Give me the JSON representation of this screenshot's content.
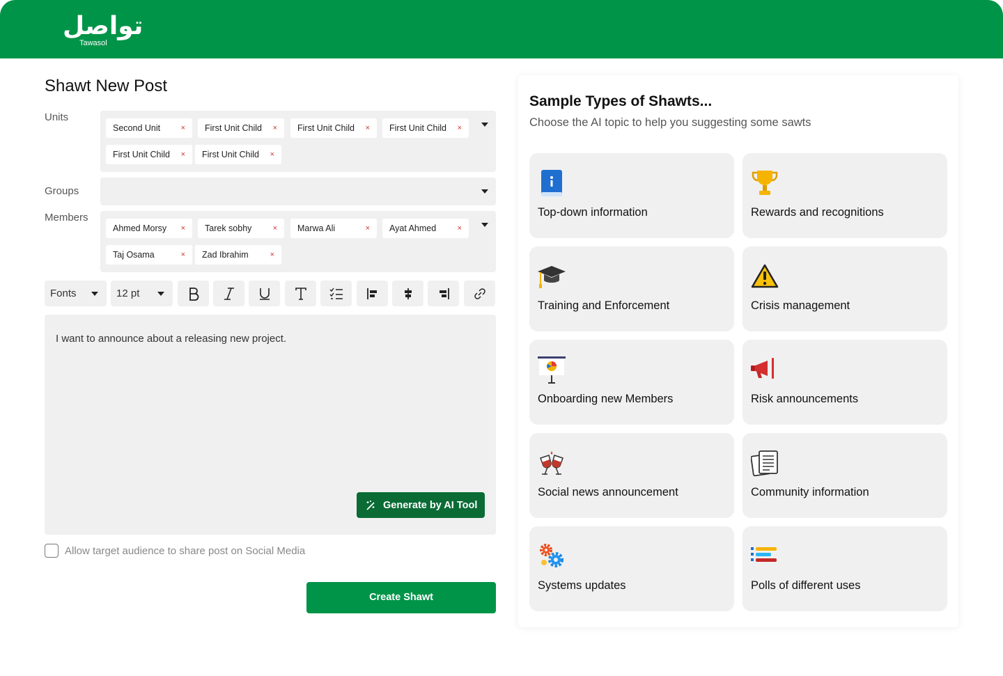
{
  "brand": {
    "logo_arabic": "تواصل",
    "logo_english": "Tawasol"
  },
  "form": {
    "title": "Shawt New Post",
    "units": {
      "label": "Units",
      "chips": [
        "Second Unit",
        "First Unit Child",
        "First Unit Child",
        "First Unit Child",
        "First Unit Child",
        "First Unit Child"
      ],
      "remove_glyph": "×"
    },
    "groups": {
      "label": "Groups"
    },
    "members": {
      "label": "Members",
      "chips": [
        "Ahmed Morsy",
        "Tarek sobhy",
        "Marwa Ali",
        "Ayat Ahmed",
        "Taj Osama",
        "Zad Ibrahim"
      ],
      "remove_glyph": "×"
    },
    "toolbar": {
      "font_select": "Fonts",
      "size_select": "12 pt",
      "buttons": [
        "bold-icon",
        "italic-icon",
        "underline-icon",
        "text-style-icon",
        "checklist-icon",
        "align-left-icon",
        "align-center-icon",
        "align-right-icon",
        "link-icon"
      ]
    },
    "editor_text": "I want to announce about a releasing new project.",
    "generate_label": "Generate by AI Tool",
    "share_checkbox_label": "Allow target audience to share post on Social Media",
    "share_checked": false,
    "submit_label": "Create Shawt"
  },
  "sidebar": {
    "title": "Sample Types of Shawts...",
    "subtitle": "Choose the AI topic to help you suggesting some sawts",
    "topics": [
      {
        "label": "Top-down information",
        "icon": "info-book-icon"
      },
      {
        "label": "Rewards and recognitions",
        "icon": "trophy-icon"
      },
      {
        "label": "Training and Enforcement",
        "icon": "graduation-cap-icon"
      },
      {
        "label": "Crisis management",
        "icon": "warning-icon"
      },
      {
        "label": "Onboarding new Members",
        "icon": "presentation-board-icon"
      },
      {
        "label": "Risk announcements",
        "icon": "megaphone-icon"
      },
      {
        "label": "Social news announcement",
        "icon": "toast-glasses-icon"
      },
      {
        "label": "Community information",
        "icon": "documents-icon"
      },
      {
        "label": "Systems updates",
        "icon": "gears-icon"
      },
      {
        "label": "Polls of different uses",
        "icon": "poll-bars-icon"
      }
    ]
  },
  "colors": {
    "brand_green": "#009448",
    "dark_green": "#0a6b35",
    "field_bg": "#f0f0f0",
    "chip_remove": "#d0342c"
  }
}
